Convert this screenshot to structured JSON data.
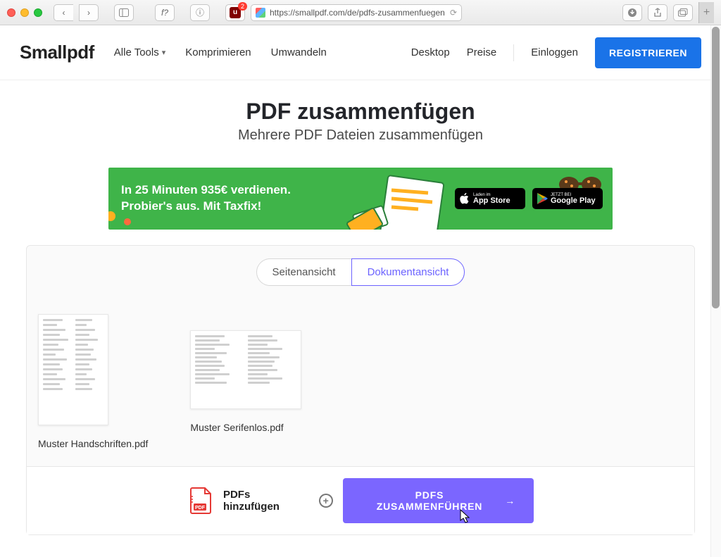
{
  "browser": {
    "url": "https://smallpdf.com/de/pdfs-zusammenfuegen",
    "ublock_badge": "2"
  },
  "header": {
    "logo": "Smallpdf",
    "nav": {
      "all_tools": "Alle Tools",
      "compress": "Komprimieren",
      "convert": "Umwandeln",
      "desktop": "Desktop",
      "pricing": "Preise",
      "login": "Einloggen",
      "register": "REGISTRIEREN"
    }
  },
  "hero": {
    "title": "PDF zusammenfügen",
    "subtitle": "Mehrere PDF Dateien zusammenfügen"
  },
  "ad": {
    "line1": "In 25 Minuten 935€ verdienen.",
    "line2": "Probier's aus. Mit Taxfix!",
    "apple_tiny": "Laden im",
    "apple_big": "App Store",
    "google_tiny": "JETZT BEI",
    "google_big": "Google Play"
  },
  "view_toggle": {
    "page_view": "Seitenansicht",
    "doc_view": "Dokumentansicht"
  },
  "documents": [
    {
      "name": "Muster Handschriften.pdf",
      "orientation": "portrait"
    },
    {
      "name": "Muster Serifenlos.pdf",
      "orientation": "landscape"
    }
  ],
  "footer": {
    "add_label": "PDFs hinzufügen",
    "merge_label": "PDFS ZUSAMMENFÜHREN"
  }
}
